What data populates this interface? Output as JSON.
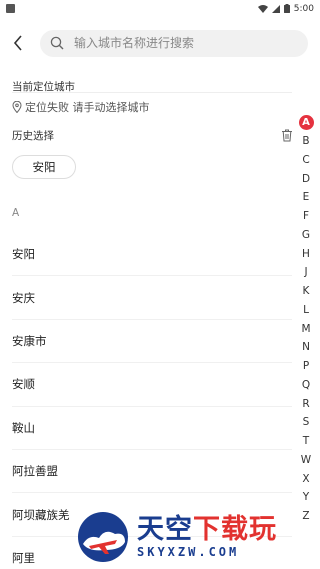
{
  "status_bar": {
    "time": "5:00"
  },
  "search": {
    "placeholder": "输入城市名称进行搜索"
  },
  "current_location": {
    "title": "当前定位城市",
    "message": "定位失败 请手动选择城市"
  },
  "history": {
    "title": "历史选择",
    "items": [
      "安阳"
    ]
  },
  "group": {
    "header": "A",
    "cities": [
      "安阳",
      "安庆",
      "安康市",
      "安顺",
      "鞍山",
      "阿拉善盟",
      "阿坝藏族羌",
      "阿里"
    ]
  },
  "index_bar": {
    "active": "A",
    "letters": [
      "A",
      "B",
      "C",
      "D",
      "E",
      "F",
      "G",
      "H",
      "J",
      "K",
      "L",
      "M",
      "N",
      "P",
      "Q",
      "R",
      "S",
      "T",
      "W",
      "X",
      "Y",
      "Z"
    ]
  },
  "watermark": {
    "cn_main": "天空",
    "cn_accent": "下载玩",
    "en": "SKYXZW.COM"
  },
  "colors": {
    "accent": "#e5323f",
    "watermark_blue": "#1a3d8f"
  }
}
